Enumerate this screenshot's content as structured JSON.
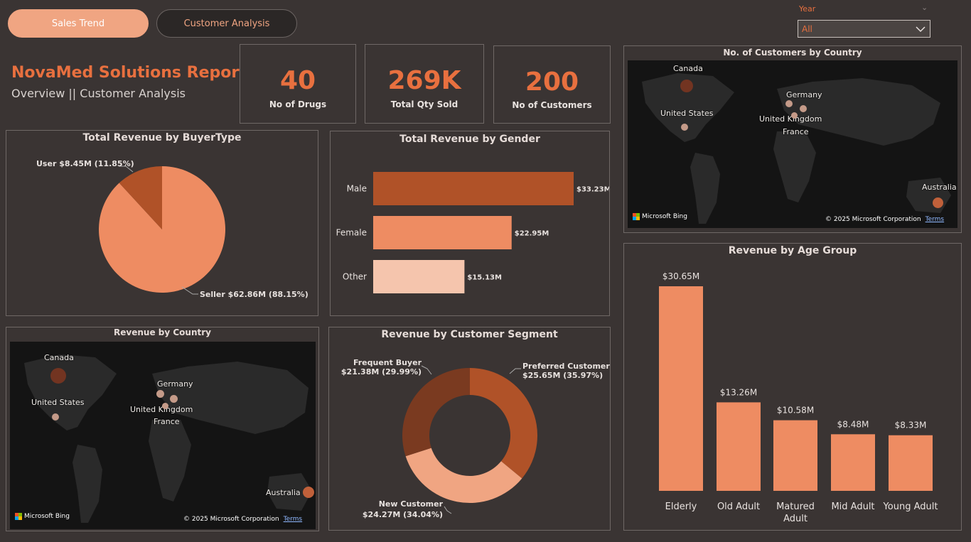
{
  "tabs": [
    {
      "label": "Sales Trend",
      "active": true
    },
    {
      "label": "Customer Analysis",
      "active": false
    }
  ],
  "filter": {
    "label": "Year",
    "value": "All"
  },
  "report": {
    "title": "NovaMed Solutions Report",
    "subtitle": "Overview || Customer Analysis"
  },
  "kpis": [
    {
      "value": "40",
      "label": "No of Drugs"
    },
    {
      "value": "269K",
      "label": "Total Qty Sold"
    },
    {
      "value": "200",
      "label": "No of Customers"
    }
  ],
  "maps": {
    "customers_title": "No. of Customers by Country",
    "revenue_title": "Revenue by Country",
    "countries": [
      "Canada",
      "United States",
      "Germany",
      "United Kingdom",
      "France",
      "Australia"
    ],
    "bing_label": "Microsoft Bing",
    "copyright": "© 2025 Microsoft Corporation",
    "terms": "Terms"
  },
  "colors": {
    "accent": "#e8703f",
    "background": "#3a3433",
    "dark_orange": "#b05228",
    "mid_orange": "#ee8c62",
    "light_orange": "#f5c5ad"
  },
  "chart_data": [
    {
      "type": "pie",
      "title": "Total Revenue by BuyerType",
      "slices": [
        {
          "name": "Seller",
          "value": 62.86,
          "percent": 88.15,
          "label": "Seller $62.86M (88.15%)",
          "color": "#ee8c62"
        },
        {
          "name": "User",
          "value": 8.45,
          "percent": 11.85,
          "label": "User $8.45M (11.85%)",
          "color": "#b05228"
        }
      ]
    },
    {
      "type": "bar",
      "orientation": "horizontal",
      "title": "Total Revenue by Gender",
      "categories": [
        "Male",
        "Female",
        "Other"
      ],
      "values": [
        33.23,
        22.95,
        15.13
      ],
      "value_labels": [
        "$33.23M",
        "$22.95M",
        "$15.13M"
      ],
      "colors": [
        "#b05228",
        "#ee8c62",
        "#f5c5ad"
      ]
    },
    {
      "type": "pie",
      "title": "Revenue by Customer Segment",
      "donut": true,
      "slices": [
        {
          "name": "Preferred Customer",
          "value": 25.65,
          "percent": 35.97,
          "label": "$25.65M (35.97%)",
          "color": "#b05228"
        },
        {
          "name": "New Customer",
          "value": 24.27,
          "percent": 34.04,
          "label": "$24.27M (34.04%)",
          "color": "#f0a582"
        },
        {
          "name": "Frequent Buyer",
          "value": 21.38,
          "percent": 29.99,
          "label": "$21.38M (29.99%)",
          "color": "#7a3a20"
        }
      ]
    },
    {
      "type": "bar",
      "title": "Revenue by Age Group",
      "categories": [
        "Elderly",
        "Old Adult",
        "Matured Adult",
        "Mid Adult",
        "Young Adult"
      ],
      "values": [
        30.65,
        13.26,
        10.58,
        8.48,
        8.33
      ],
      "value_labels": [
        "$30.65M",
        "$13.26M",
        "$10.58M",
        "$8.48M",
        "$8.33M"
      ],
      "color": "#ee8c62"
    }
  ]
}
